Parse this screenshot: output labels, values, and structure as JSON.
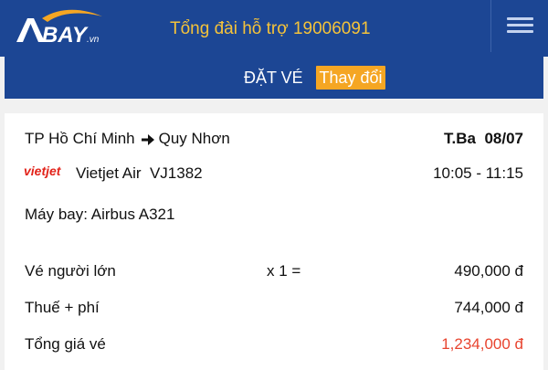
{
  "header": {
    "logo_text": "BAY",
    "logo_suffix": ".vn",
    "hotline": "Tổng đài hỗ trợ 19006091",
    "menu_icon": "hamburger-menu-icon"
  },
  "booking_bar": {
    "title": "ĐẶT VÉ",
    "change_label": "Thay đổi"
  },
  "flight": {
    "origin": "TP Hồ Chí Minh",
    "route_icon": "arrow-right-icon",
    "destination": "Quy Nhơn",
    "day": "T.Ba",
    "date": "08/07",
    "airline_logo_text": "vietjet",
    "airline": "Vietjet Air",
    "flight_number": "VJ1382",
    "time": "10:05 - 11:15",
    "aircraft": "Máy bay: Airbus A321"
  },
  "pricing": {
    "adult_label": "Vé người lớn",
    "adult_qty": "x 1 =",
    "adult_price": "490,000 đ",
    "tax_label": "Thuế + phí",
    "tax_price": "744,000 đ",
    "total_label": "Tổng giá vé",
    "total_price": "1,234,000 đ"
  },
  "colors": {
    "header_bg": "#1c4694",
    "hotline": "#f5c33a",
    "change_button": "#f5a623",
    "total_price": "#e8442f"
  }
}
